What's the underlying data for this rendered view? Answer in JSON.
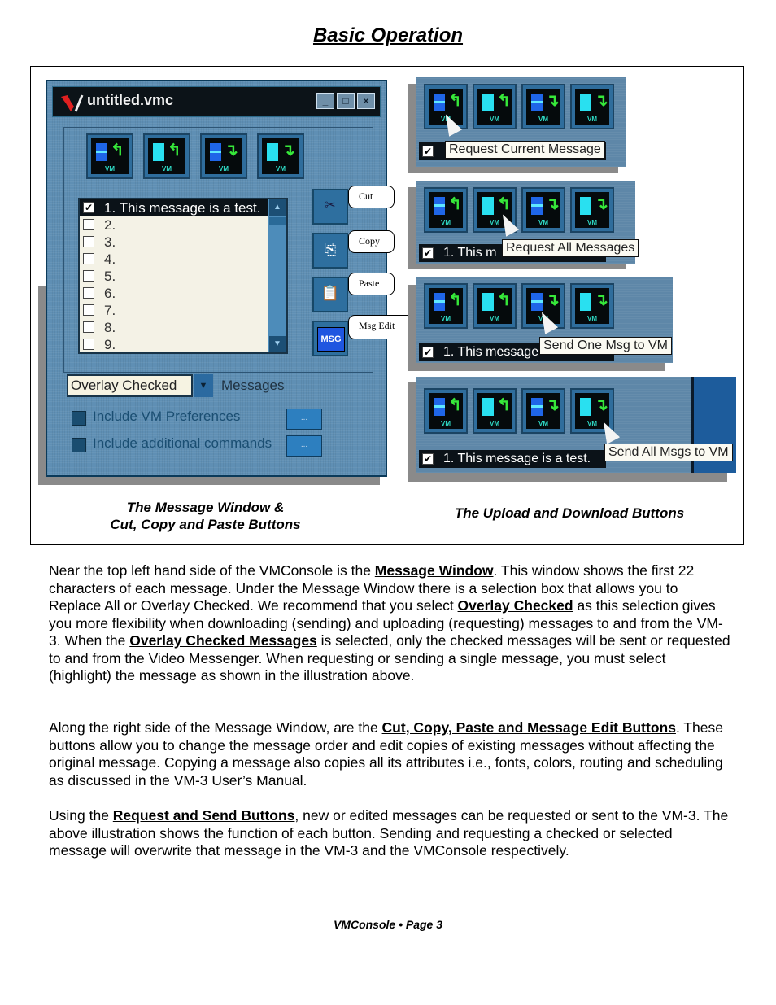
{
  "page": {
    "title": "Basic Operation",
    "footer": "VMConsole • Page 3"
  },
  "message_window": {
    "title": "untitled.vmc",
    "window_buttons": [
      "_",
      "□",
      "×"
    ],
    "toolbar_buttons": [
      {
        "icon": "request-current-message-icon",
        "label": "VM"
      },
      {
        "icon": "request-all-messages-icon",
        "label": "VM"
      },
      {
        "icon": "send-one-msg-icon",
        "label": "VM"
      },
      {
        "icon": "send-all-msgs-icon",
        "label": "VM"
      }
    ],
    "messages": [
      {
        "text": "1.  This message is a test.",
        "checked": true,
        "selected": true
      },
      {
        "text": "2.",
        "checked": false
      },
      {
        "text": "3.",
        "checked": false
      },
      {
        "text": "4.",
        "checked": false
      },
      {
        "text": "5.",
        "checked": false
      },
      {
        "text": "6.",
        "checked": false
      },
      {
        "text": "7.",
        "checked": false
      },
      {
        "text": "8.",
        "checked": false
      },
      {
        "text": "9.",
        "checked": false
      }
    ],
    "checkmark": "✔",
    "mode_select": {
      "value": "Overlay Checked",
      "suffix": "Messages"
    },
    "options": [
      {
        "label": "Include VM Preferences",
        "button": "..."
      },
      {
        "label": "Include additional commands",
        "button": "..."
      }
    ],
    "side_buttons": [
      {
        "name": "cut",
        "callout": "Cut",
        "glyph": "✂"
      },
      {
        "name": "copy",
        "callout": "Copy",
        "glyph": "⎘"
      },
      {
        "name": "paste",
        "callout": "Paste",
        "glyph": "📋"
      },
      {
        "name": "msg-edit",
        "callout": "Msg Edit",
        "glyph": "MSG"
      }
    ],
    "caption_line1": "The Message Window &",
    "caption_line2": "Cut, Copy and Paste Buttons"
  },
  "upload_download": {
    "panels": [
      {
        "tooltip": "Request Current Message",
        "row_text": ""
      },
      {
        "tooltip": "Request All Messages",
        "row_text": "1.  This m"
      },
      {
        "tooltip": "Send One Msg to VM",
        "row_text": "1.  This message"
      },
      {
        "tooltip": "Send All Msgs to VM",
        "row_text": "1.  This message is a test."
      }
    ],
    "caption": "The Upload and Download Buttons"
  },
  "body": {
    "p1": {
      "t1": "Near the top left hand side of the VMConsole is the ",
      "b1": "Message Window",
      "t2": ". This window shows the first 22 characters of each message. Under the Message Window there is a selection box that allows you to Replace All or Overlay Checked. We recommend that you select ",
      "b2": "Overlay Checked",
      "t3": " as this selection gives you more flexibility when downloading (sending) and uploading (requesting) messages to and from the VM-3. When the ",
      "b3": "Overlay Checked Messages",
      "t4": " is selected, only the checked messages will be sent or requested to and from the Video Messenger. When requesting or sending a single message, you must select (highlight) the message as shown in the illustration above."
    },
    "p2": {
      "t1": "Along the right side of the Message Window, are the ",
      "b1": "Cut, Copy, Paste and Message Edit Buttons",
      "t2": ". These buttons allow you to change the message order and edit copies of existing messages without affecting the original message. Copying a message also copies all its attributes i.e., fonts, colors, routing and scheduling as discussed in the VM-3 User’s Manual."
    },
    "p3": {
      "t1": "Using the ",
      "b1": "Request and Send Buttons",
      "t2": ", new or edited messages can be requested or sent to the VM-3. The above illustration shows the function of each button. Sending and requesting a checked or selected message will overwrite that message in the VM-3 and the VMConsole respectively."
    }
  }
}
